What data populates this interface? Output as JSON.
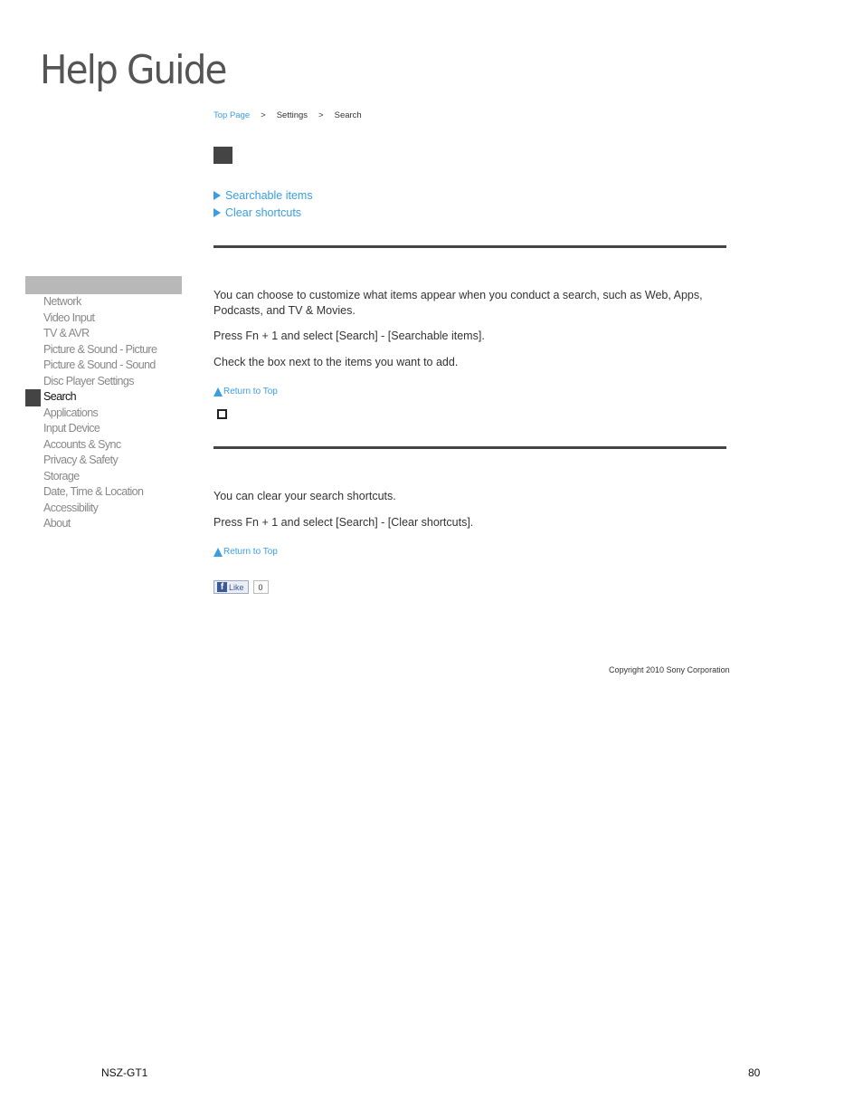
{
  "header": {
    "logo_text": "Help Guide"
  },
  "breadcrumb": {
    "items": [
      "Top Page",
      "Settings",
      "Search"
    ],
    "separator": ">"
  },
  "toc": {
    "items": [
      "Searchable items",
      "Clear shortcuts"
    ]
  },
  "sidebar": {
    "items": [
      "Network",
      "Video Input",
      "TV & AVR",
      "Picture & Sound - Picture",
      "Picture & Sound - Sound",
      "Disc Player Settings",
      "Search",
      "Applications",
      "Input Device",
      "Accounts & Sync",
      "Privacy & Safety",
      "Storage",
      "Date, Time & Location",
      "Accessibility",
      "About"
    ],
    "active": "Search"
  },
  "section1": {
    "paragraphs": [
      "You can choose to customize what items appear when you conduct a search, such as Web, Apps, Podcasts, and TV & Movies.",
      "Press Fn + 1 and select [Search] - [Searchable items].",
      "Check the box next to the items you want to add."
    ],
    "return_to_top": "Return to Top",
    "icon": "checkbox-icon"
  },
  "section2": {
    "paragraphs": [
      "You can clear your search shortcuts.",
      "Press Fn + 1 and select [Search] - [Clear shortcuts]."
    ],
    "return_to_top": "Return to Top"
  },
  "like_widget": {
    "label": "Like",
    "count": "0"
  },
  "copyright": "Copyright 2010 Sony Corporation",
  "footer": {
    "model": "NSZ-GT1",
    "page_number": "80"
  },
  "colors": {
    "link": "#3a9ee0",
    "dark_block": "#444444",
    "sidebar_head": "#b8b8b8",
    "sidebar_text": "#888888"
  }
}
